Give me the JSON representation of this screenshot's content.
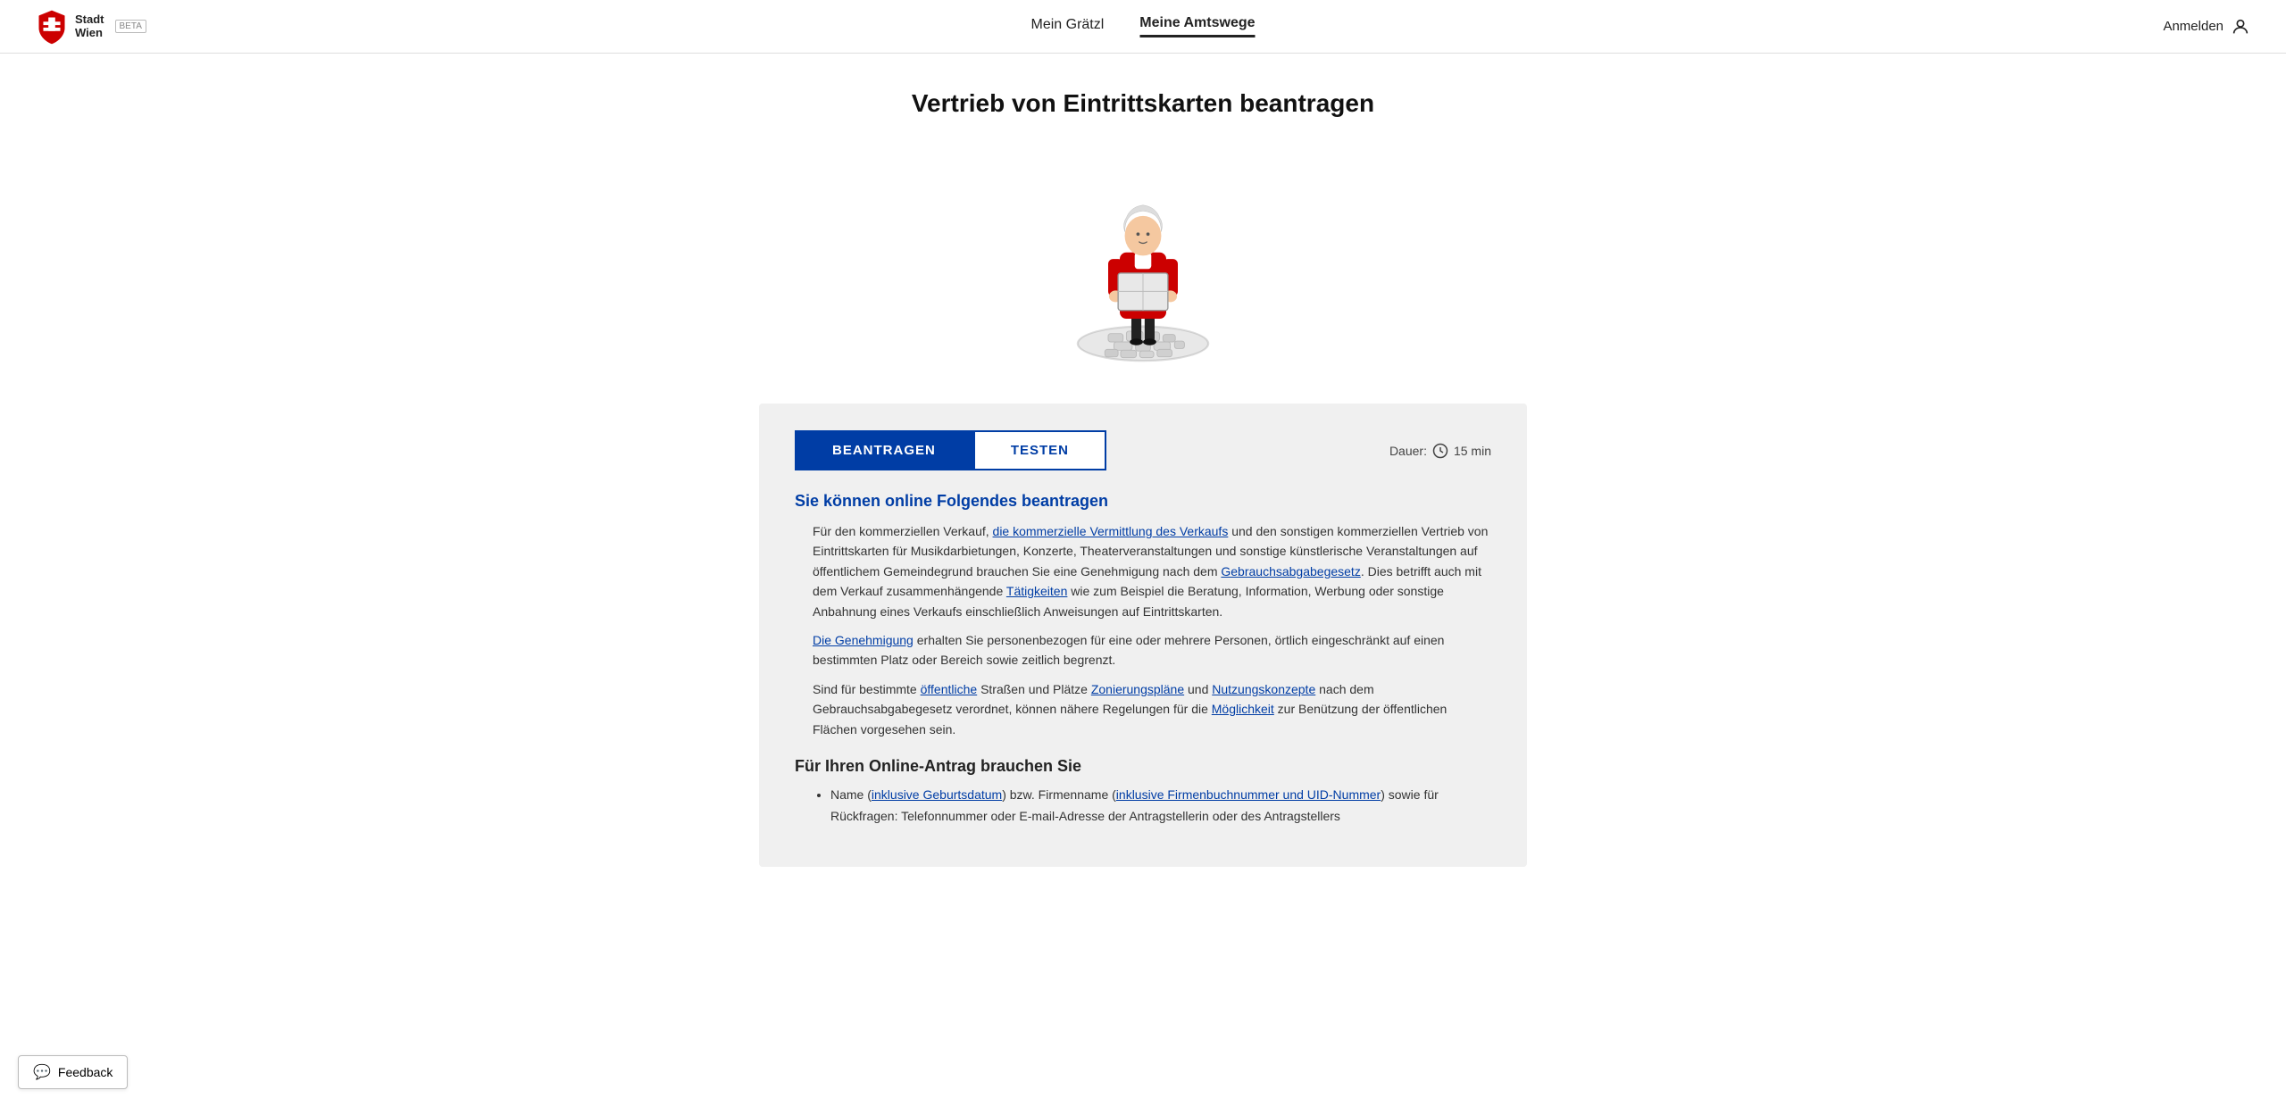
{
  "header": {
    "logo": {
      "line1": "Stadt",
      "line2": "Wien",
      "beta": "BETA"
    },
    "nav": [
      {
        "label": "Mein Grätzl",
        "active": false
      },
      {
        "label": "Meine Amtswege",
        "active": true
      }
    ],
    "login": "Anmelden"
  },
  "page": {
    "title": "Vertrieb von Eintrittskarten beantragen"
  },
  "tabs": [
    {
      "label": "BEANTRAGEN",
      "active": true
    },
    {
      "label": "TESTEN",
      "active": false
    }
  ],
  "duration": {
    "label": "Dauer:",
    "value": "15 min"
  },
  "content": {
    "section1_heading": "Sie können online Folgendes beantragen",
    "section1_paragraphs": [
      "Für den kommerziellen Verkauf, die kommerzielle Vermittlung des Verkaufs und den sonstigen kommerziellen Vertrieb von Eintrittskarten für Musikdarbietungen, Konzerte, Theaterveranstaltungen und sonstige künstlerische Veranstaltungen auf öffentlichem Gemeindegrund brauchen Sie eine Genehmigung nach dem Gebrauchsabgabegesetz. Dies betrifft auch mit dem Verkauf zusammenhängende Tätigkeiten wie zum Beispiel die Beratung, Information, Werbung oder sonstige Anbahnung eines Verkaufs einschließlich Anweisungen auf Eintrittskarten.",
      "Die Genehmigung erhalten Sie personenbezogen für eine oder mehrere Personen, örtlich eingeschränkt auf einen bestimmten Platz oder Bereich sowie zeitlich begrenzt.",
      "Sind für bestimmte öffentliche Straßen und Plätze Zonierungspläne und Nutzungskonzepte nach dem Gebrauchsabgabegesetz verordnet, können nähere Regelungen für die Möglichkeit zur Benützung der öffentlichen Flächen vorgesehen sein."
    ],
    "section2_heading": "Für Ihren Online-Antrag brauchen Sie",
    "section2_items": [
      "Name (inklusive Geburtsdatum) bzw. Firmenname (inklusive Firmenbuchnummer und UID-Nummer) sowie für Rückfragen: Telefonnummer oder E-mail-Adresse der Antragstellerin oder des Antragstellers"
    ]
  },
  "feedback": {
    "label": "Feedback",
    "icon": "💬"
  }
}
